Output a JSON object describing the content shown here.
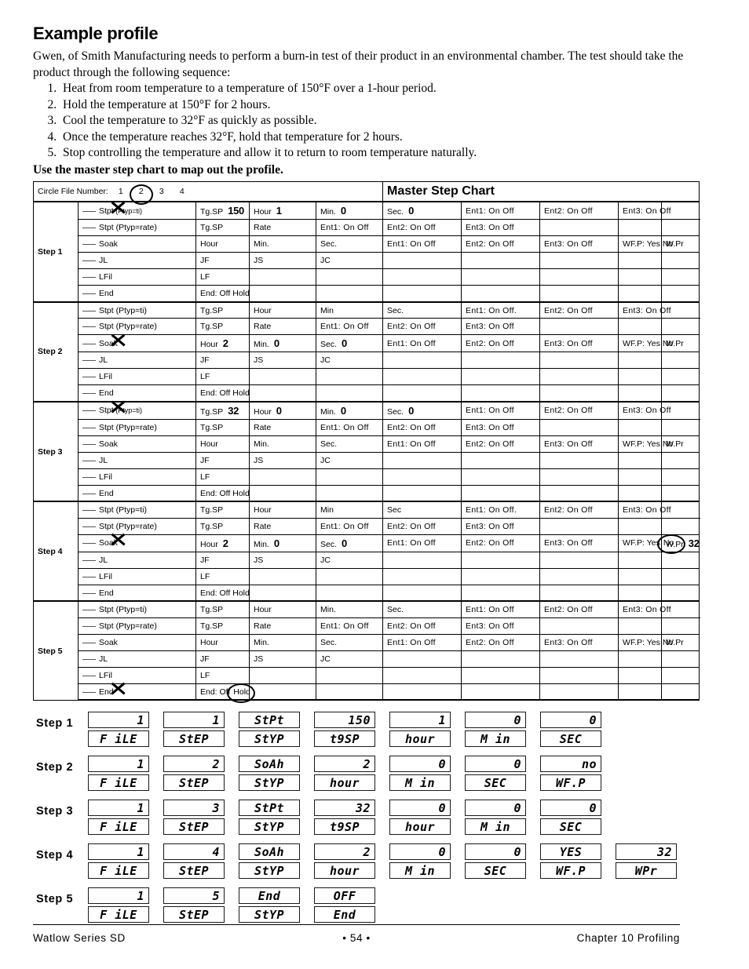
{
  "heading": "Example profile",
  "intro": "Gwen, of Smith Manufacturing needs to perform a burn-in test of their product in an environmental chamber. The test should take the product through the following sequence:",
  "sequence": [
    "Heat from room temperature to a temperature of 150°F over a 1-hour period.",
    "Hold the temperature at 150°F for 2 hours.",
    "Cool the temperature to 32°F as quickly as possible.",
    "Once the temperature reaches 32°F, hold that temperature for 2 hours.",
    "Stop controlling the temperature and allow it to return to room temperature naturally."
  ],
  "use_chart_note": "Use the master step chart to map out the profile.",
  "chart_header": {
    "circle_file_label": "Circle File Number:",
    "file_numbers": [
      "1",
      "2",
      "3",
      "4"
    ],
    "circled_file_number": "2",
    "title": "Master Step Chart"
  },
  "labels": {
    "stpt_ti": "Stpt (Ptyp=ti)",
    "stpt_rate": "Stpt (Ptyp=rate)",
    "soak": "Soak",
    "jl": "JL",
    "lfil": "LFil",
    "end": "End",
    "tgsp": "Tg.SP",
    "hour": "Hour",
    "min": "Min.",
    "min_nodot": "Min",
    "sec": "Sec.",
    "sec_nodot": "Sec",
    "rate": "Rate",
    "ent1": "Ent1:  On  Off",
    "ent1_dot": "Ent1:  On  Off.",
    "ent2": "Ent2:  On  Off",
    "ent3": "Ent3:  On  Off",
    "wfp": "WF.P: Yes No",
    "wfp_yes": "WF.P: Yes",
    "wfp_no": "No",
    "wpr": "W.Pr",
    "jf": "JF",
    "js": "JS",
    "jc": "JC",
    "lf": "LF",
    "end_offhold": "End: Off Hold",
    "end_off": "End: Off",
    "end_hold": "Hold"
  },
  "steps": [
    {
      "name": "Step 1",
      "marked_row": "stpt_ti",
      "values": {
        "tgsp": "150",
        "hour": "1",
        "min": "0",
        "sec": "0"
      }
    },
    {
      "name": "Step 2",
      "marked_row": "soak",
      "values": {
        "hour": "2",
        "min": "0",
        "sec": "0"
      }
    },
    {
      "name": "Step 3",
      "marked_row": "stpt_ti",
      "values": {
        "tgsp": "32",
        "hour": "0",
        "min": "0",
        "sec": "0"
      }
    },
    {
      "name": "Step 4",
      "marked_row": "soak",
      "values": {
        "hour": "2",
        "min": "0",
        "sec": "0",
        "wpr": "32"
      },
      "circled": "No"
    },
    {
      "name": "Step 5",
      "marked_row": "end",
      "circled": "Hold"
    }
  ],
  "lcd": {
    "steps": [
      {
        "label": "Step 1",
        "cells": [
          {
            "value": "1",
            "label": "F iLE"
          },
          {
            "value": "1",
            "label": "StEP"
          },
          {
            "value": "StPt",
            "label": "StYP"
          },
          {
            "value": "150",
            "label": "t9SP"
          },
          {
            "value": "1",
            "label": "hour"
          },
          {
            "value": "0",
            "label": "M in"
          },
          {
            "value": "0",
            "label": "SEC"
          }
        ]
      },
      {
        "label": "Step 2",
        "cells": [
          {
            "value": "1",
            "label": "F iLE"
          },
          {
            "value": "2",
            "label": "StEP"
          },
          {
            "value": "SoAh",
            "label": "StYP"
          },
          {
            "value": "2",
            "label": "hour"
          },
          {
            "value": "0",
            "label": "M in"
          },
          {
            "value": "0",
            "label": "SEC"
          },
          {
            "value": "no",
            "label": "WF.P"
          }
        ]
      },
      {
        "label": "Step 3",
        "cells": [
          {
            "value": "1",
            "label": "F iLE"
          },
          {
            "value": "3",
            "label": "StEP"
          },
          {
            "value": "StPt",
            "label": "StYP"
          },
          {
            "value": "32",
            "label": "t9SP"
          },
          {
            "value": "0",
            "label": "hour"
          },
          {
            "value": "0",
            "label": "M in"
          },
          {
            "value": "0",
            "label": "SEC"
          }
        ]
      },
      {
        "label": "Step 4",
        "cells": [
          {
            "value": "1",
            "label": "F iLE"
          },
          {
            "value": "4",
            "label": "StEP"
          },
          {
            "value": "SoAh",
            "label": "StYP"
          },
          {
            "value": "2",
            "label": "hour"
          },
          {
            "value": "0",
            "label": "M in"
          },
          {
            "value": "0",
            "label": "SEC"
          },
          {
            "value": "YES",
            "label": "WF.P"
          },
          {
            "value": "32",
            "label": "WPr"
          }
        ]
      },
      {
        "label": "Step 5",
        "cells": [
          {
            "value": "1",
            "label": "F iLE"
          },
          {
            "value": "5",
            "label": "StEP"
          },
          {
            "value": "End",
            "label": "StYP"
          },
          {
            "value": "OFF",
            "label": "End"
          }
        ]
      }
    ]
  },
  "footer": {
    "left": "Watlow Series SD",
    "center": "•  54  •",
    "right": "Chapter 10 Profiling"
  }
}
